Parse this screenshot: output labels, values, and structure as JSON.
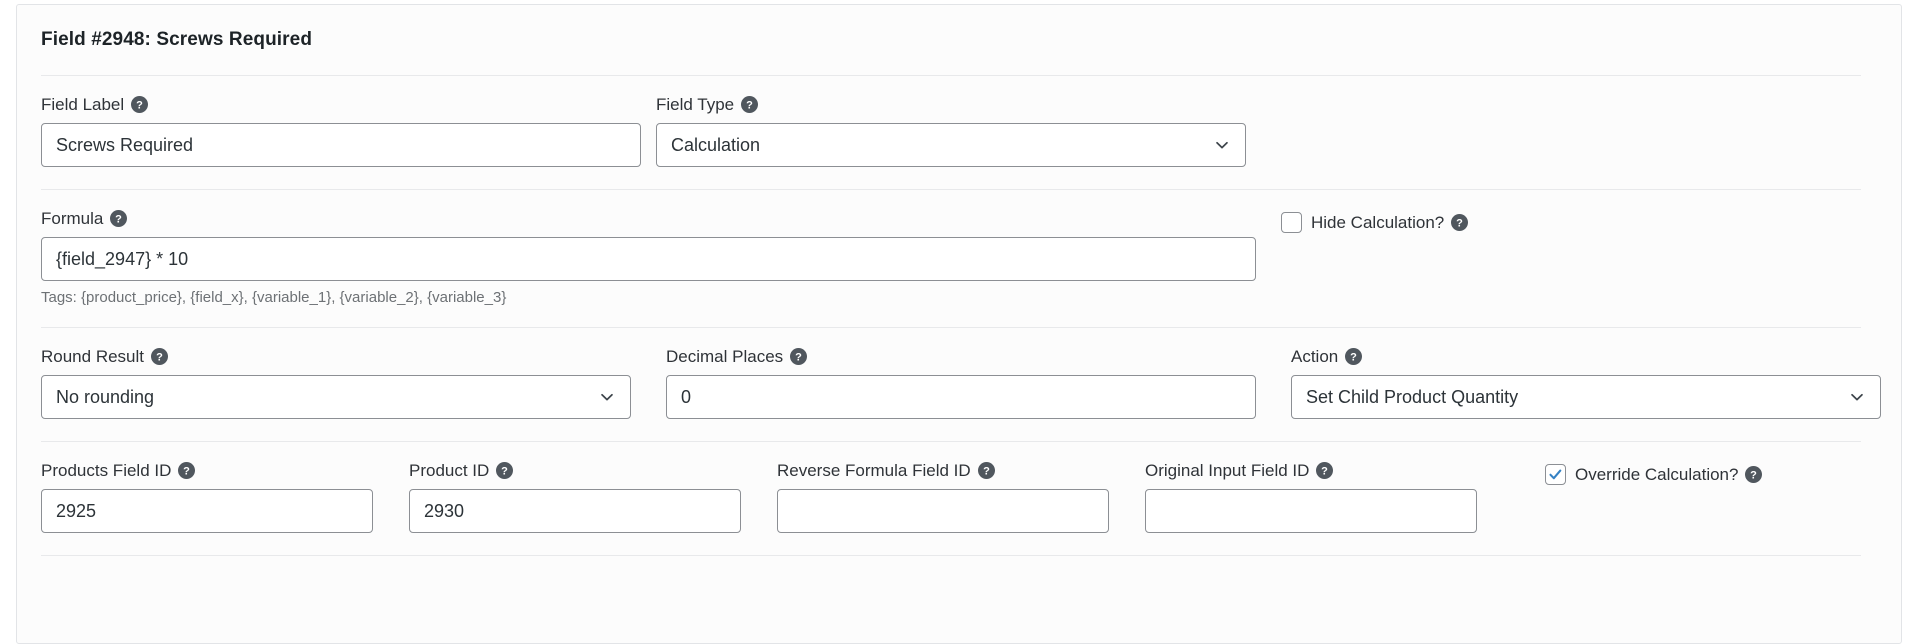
{
  "card": {
    "header_title": "Field #2948: Screws Required"
  },
  "colors": {
    "accent_checkbox": "#3582c4",
    "border_input": "#8c8f94",
    "card_border": "#e2e4e7",
    "text": "#2c3338",
    "muted_text": "#6d7175",
    "help_icon": "#50575e"
  },
  "icons": {
    "help": "help-icon",
    "chevron_down": "chevron-down-icon",
    "checkmark": "checkmark-icon"
  },
  "rows": {
    "row1": {
      "field_label": {
        "label": "Field Label",
        "value": "Screws Required",
        "placeholder": ""
      },
      "field_type": {
        "label": "Field Type",
        "value": "Calculation"
      }
    },
    "row2": {
      "formula": {
        "label": "Formula",
        "value": "{field_2947} * 10",
        "hint": "Tags: {product_price}, {field_x}, {variable_1}, {variable_2}, {variable_3}"
      },
      "hide_calculation": {
        "label": "Hide Calculation?",
        "checked": false
      }
    },
    "row3": {
      "round_result": {
        "label": "Round Result",
        "value": "No rounding"
      },
      "decimal_places": {
        "label": "Decimal Places",
        "value": "0"
      },
      "action": {
        "label": "Action",
        "value": "Set Child Product Quantity"
      }
    },
    "row4": {
      "products_field_id": {
        "label": "Products Field ID",
        "value": "2925"
      },
      "product_id": {
        "label": "Product ID",
        "value": "2930"
      },
      "reverse_formula_field_id": {
        "label": "Reverse Formula Field ID",
        "value": ""
      },
      "original_input_field_id": {
        "label": "Original Input Field ID",
        "value": ""
      },
      "override_calculation": {
        "label": "Override Calculation?",
        "checked": true
      }
    }
  }
}
